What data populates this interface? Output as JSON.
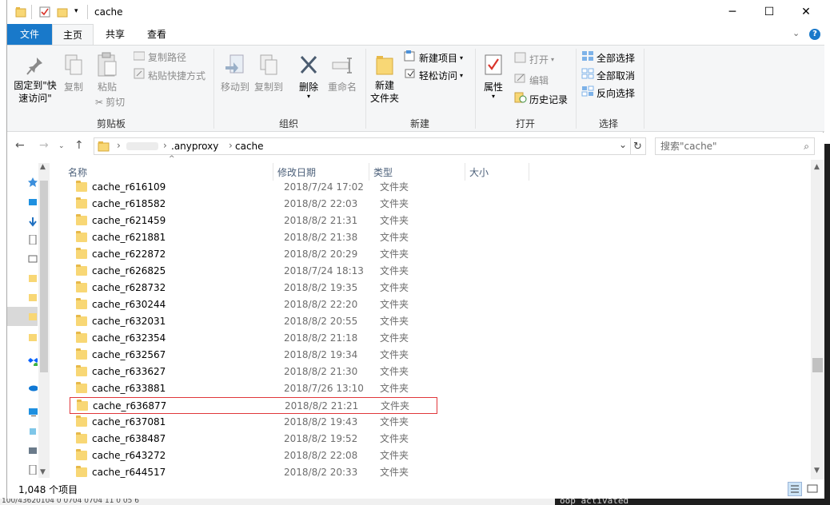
{
  "window": {
    "title": "cache"
  },
  "ribbon_tabs": [
    "文件",
    "主页",
    "共享",
    "查看"
  ],
  "ribbon": {
    "clipboard": {
      "pin_label": "固定到\"快速访问\"",
      "copy_label": "复制",
      "paste_label": "粘贴",
      "copy_path_label": "复制路径",
      "paste_shortcut_label": "粘贴快捷方式",
      "cut_label": "剪切",
      "group_label": "剪贴板"
    },
    "organize": {
      "move_to_label": "移动到",
      "copy_to_label": "复制到",
      "delete_label": "删除",
      "rename_label": "重命名",
      "group_label": "组织"
    },
    "new": {
      "new_folder_label": "新建\n文件夹",
      "new_item_label": "新建项目",
      "easy_access_label": "轻松访问",
      "group_label": "新建"
    },
    "open": {
      "properties_label": "属性",
      "open_label": "打开",
      "edit_label": "编辑",
      "history_label": "历史记录",
      "group_label": "打开"
    },
    "select": {
      "select_all_label": "全部选择",
      "select_none_label": "全部取消",
      "invert_label": "反向选择",
      "group_label": "选择"
    }
  },
  "address": {
    "segments": [
      ".anyproxy",
      "cache"
    ],
    "search_placeholder": "搜索\"cache\""
  },
  "columns": {
    "name": "名称",
    "date": "修改日期",
    "type": "类型",
    "size": "大小"
  },
  "files": [
    {
      "name": "cache_r616109",
      "date": "2018/7/24 17:02",
      "type": "文件夹"
    },
    {
      "name": "cache_r618582",
      "date": "2018/8/2 22:03",
      "type": "文件夹"
    },
    {
      "name": "cache_r621459",
      "date": "2018/8/2 21:31",
      "type": "文件夹"
    },
    {
      "name": "cache_r621881",
      "date": "2018/8/2 21:38",
      "type": "文件夹"
    },
    {
      "name": "cache_r622872",
      "date": "2018/8/2 20:29",
      "type": "文件夹"
    },
    {
      "name": "cache_r626825",
      "date": "2018/7/24 18:13",
      "type": "文件夹"
    },
    {
      "name": "cache_r628732",
      "date": "2018/8/2 19:35",
      "type": "文件夹"
    },
    {
      "name": "cache_r630244",
      "date": "2018/8/2 22:20",
      "type": "文件夹"
    },
    {
      "name": "cache_r632031",
      "date": "2018/8/2 20:55",
      "type": "文件夹"
    },
    {
      "name": "cache_r632354",
      "date": "2018/8/2 21:18",
      "type": "文件夹"
    },
    {
      "name": "cache_r632567",
      "date": "2018/8/2 19:34",
      "type": "文件夹"
    },
    {
      "name": "cache_r633627",
      "date": "2018/8/2 21:30",
      "type": "文件夹"
    },
    {
      "name": "cache_r633881",
      "date": "2018/7/26 13:10",
      "type": "文件夹"
    },
    {
      "name": "cache_r636877",
      "date": "2018/8/2 21:21",
      "type": "文件夹",
      "highlighted": true
    },
    {
      "name": "cache_r637081",
      "date": "2018/8/2 19:43",
      "type": "文件夹"
    },
    {
      "name": "cache_r638487",
      "date": "2018/8/2 19:52",
      "type": "文件夹"
    },
    {
      "name": "cache_r643272",
      "date": "2018/8/2 22:08",
      "type": "文件夹"
    },
    {
      "name": "cache_r644517",
      "date": "2018/8/2 20:33",
      "type": "文件夹"
    }
  ],
  "status": {
    "item_count": "1,048 个项目"
  },
  "background": {
    "terminal_text": "oop activated",
    "bottom_left_text": "100/43620104 0 0704 0704 11 0 05 6"
  },
  "colors": {
    "file_tab": "#1979ca",
    "highlight_border": "#e0373b",
    "folder": "#f8d775"
  }
}
